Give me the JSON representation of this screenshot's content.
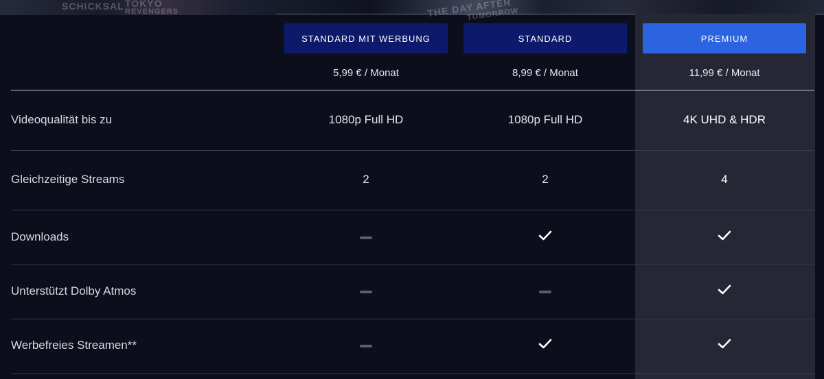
{
  "hero": {
    "texts": [
      "SCHICKSAL",
      "TOKYO",
      "REVENGERS",
      "THE DAY AFTER",
      "TOMORROW"
    ]
  },
  "plans": [
    {
      "name": "STANDARD MIT WERBUNG",
      "price": "5,99 € / Monat",
      "style": "dark"
    },
    {
      "name": "STANDARD",
      "price": "8,99 € / Monat",
      "style": "dark"
    },
    {
      "name": "PREMIUM",
      "price": "11,99 € / Monat",
      "style": "highlight"
    }
  ],
  "rows": [
    {
      "label": "Videoqualität bis zu",
      "values": [
        "1080p Full HD",
        "1080p Full HD",
        "4K UHD & HDR"
      ]
    },
    {
      "label": "Gleichzeitige Streams",
      "values": [
        "2",
        "2",
        "4"
      ]
    },
    {
      "label": "Downloads",
      "values": [
        "dash",
        "check",
        "check"
      ]
    },
    {
      "label": "Unterstützt Dolby Atmos",
      "values": [
        "dash",
        "dash",
        "check"
      ]
    },
    {
      "label": "Werbefreies Streamen**",
      "values": [
        "dash",
        "check",
        "check"
      ]
    }
  ],
  "colors": {
    "background": "#0c0e1c",
    "plan_button": "#0d1a6b",
    "premium_button": "#2b63e0",
    "premium_column": "#252834"
  }
}
